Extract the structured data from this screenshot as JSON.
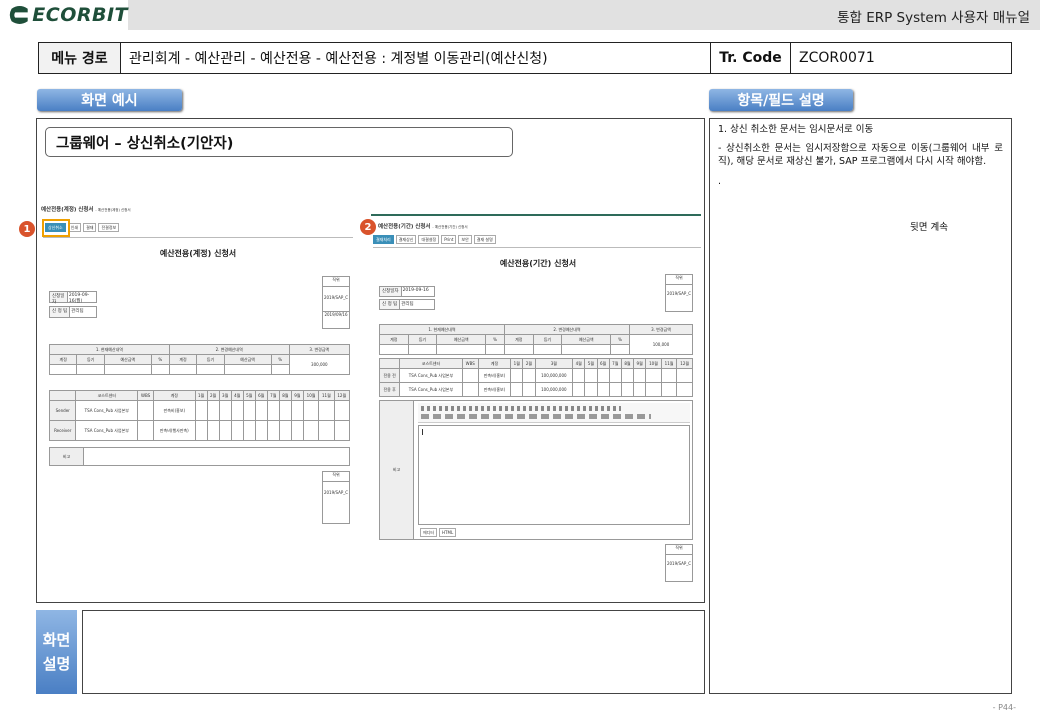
{
  "header": {
    "logo_text": "ECORBIT",
    "doc_title": "통합 ERP System 사용자 매뉴얼"
  },
  "menu_path": {
    "label": "메뉴 경로",
    "value": "관리회계 - 예산관리 - 예산전용 - 예산전용 : 계정별 이동관리(예산신청)",
    "tr_label": "Tr. Code",
    "tr_value": "ZCOR0071"
  },
  "sections": {
    "screen_example": "화면 예시",
    "field_desc": "항목/필드 설명",
    "screen_desc_line1": "화면",
    "screen_desc_line2": "설명"
  },
  "example": {
    "title": "그룹웨어 – 상신취소(기안자)",
    "badge1": "1",
    "badge2": "2",
    "form1_small_title": "예산전용(계정) 신청서",
    "form1_sub": "- 예산전용(계정) 신청서",
    "form1_tabs": [
      "상신취소",
      "인쇄",
      "결재",
      "전결정보"
    ],
    "form1_title": "예산전용(계정) 신청서",
    "form1_fields": [
      {
        "label": "신청일자",
        "value": "2019-09-16(월)"
      },
      {
        "label": "신 청 팀",
        "value": "관리팀"
      }
    ],
    "form1_approval": [
      "직위",
      "결재",
      "2019/SAP_C",
      "2019/09/16"
    ],
    "form1_sec": [
      "1. 현재예산내역",
      "2. 변경예산내역",
      "3. 변경금액"
    ],
    "form1_cols": [
      "계정",
      "등기",
      "예산금액",
      "%",
      "계정",
      "등기",
      "예산금액",
      "%"
    ],
    "form1_amount": "300,000",
    "form1_months": [
      "코스트센터",
      "WBS",
      "계정",
      "1월",
      "2월",
      "3월",
      "4월",
      "5월",
      "6월",
      "7월",
      "8월",
      "9월",
      "10월",
      "11월",
      "12월"
    ],
    "form1_rows": [
      "Sender",
      "Receiver"
    ],
    "form1_cc": "TSA Cons_Pub 사업본부",
    "form1_acct1": "판촉비(홍보)",
    "form1_acct2": "판촉비(행사판촉)",
    "form1_note": "비고",
    "form2_small_title": "예산전용(기간) 신청서",
    "form2_sub": "- 예산전용(기간) 신청서",
    "form2_tabs": [
      "결재처리",
      "결재상신",
      "대결설정",
      "Print",
      "보안",
      "결재 설명"
    ],
    "form2_title": "예산전용(기간) 신청서",
    "form2_fields": [
      {
        "label": "신청일자",
        "value": "2019-09-16"
      },
      {
        "label": "신 청 팀",
        "value": "관리팀"
      }
    ],
    "form2_sec": [
      "1. 현재예산내역",
      "2. 변경예산내역",
      "3. 변경금액"
    ],
    "form2_amount": "100,000",
    "form2_rows": [
      "전용 전",
      "전용 후"
    ],
    "form2_amt_row1": "100,000,000",
    "form2_amt_row2": "100,000,000",
    "form2_editor_label": "비고",
    "form2_editor_tabs": [
      "에디터",
      "HTML"
    ]
  },
  "field_help": {
    "item1": "1. 상신 취소한 문서는 임시문서로 이동",
    "item1_detail": "- 상신취소한 문서는 임시저장함으로 자동으로 이동(그룹웨어 내부 로직), 해당 문서로 재상신 불가, SAP 프로그램에서 다시 시작 해야함.",
    "dot": ".",
    "continue": "뒷면 계속"
  },
  "footer": {
    "page": "- P44-"
  }
}
